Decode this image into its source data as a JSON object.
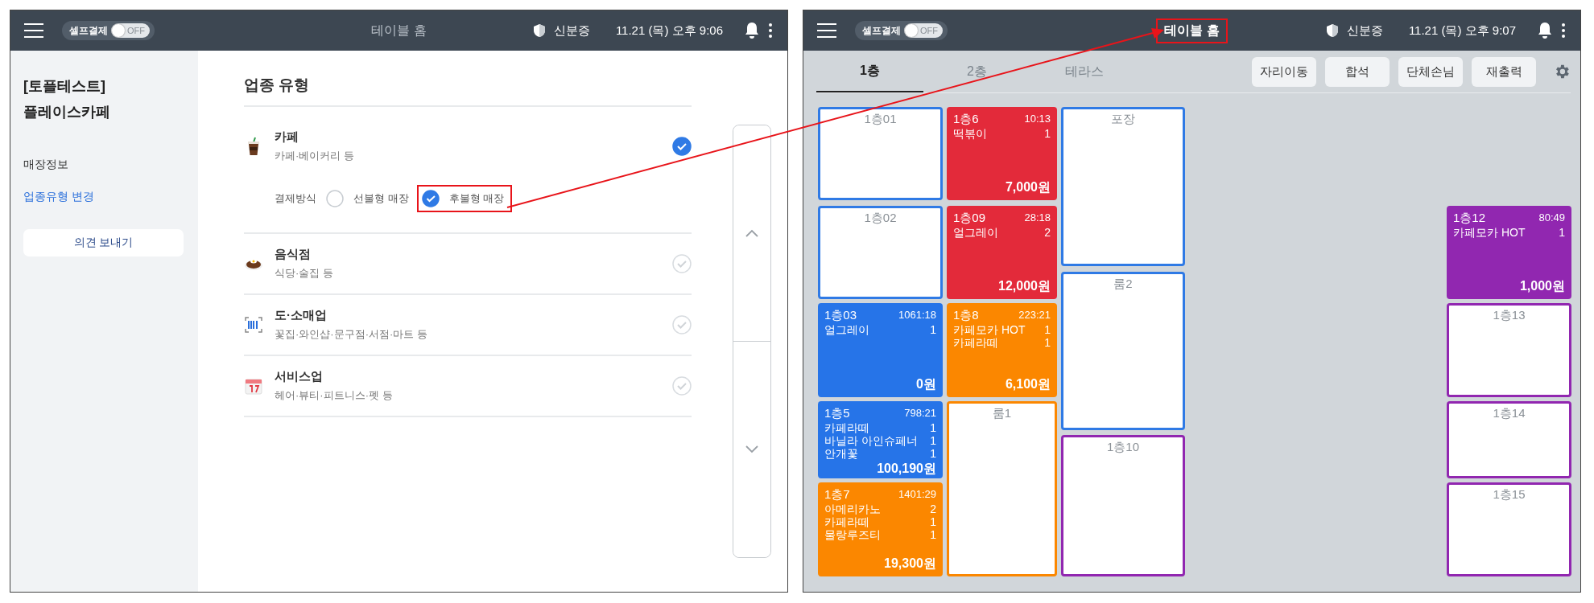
{
  "panels": [
    {
      "kind": "settings",
      "header": {
        "self_pay_label": "셀프결제",
        "self_pay_switch": {
          "text": "OFF",
          "on": false
        },
        "title": "테이블 홈",
        "title_highlighted": false,
        "id_label": "신분증",
        "datetime": "11.21 (목) 오후 9:06"
      },
      "sidebar": {
        "store_name": [
          "[토플테스트]",
          "플레이스카페"
        ],
        "items": [
          {
            "label": "매장정보",
            "selected": false
          },
          {
            "label": "업종유형 변경",
            "selected": true
          }
        ],
        "feedback_button": "의견 보내기"
      },
      "content": {
        "heading": "업종 유형",
        "categories": [
          {
            "name": "카페",
            "description": "카페·베이커리 등",
            "selected": true,
            "payment": {
              "label": "결제방식",
              "options": [
                {
                  "label": "선불형 매장",
                  "selected": false,
                  "highlighted": false
                },
                {
                  "label": "후불형 매장",
                  "selected": true,
                  "highlighted": true
                }
              ]
            }
          },
          {
            "name": "음식점",
            "description": "식당·술집 등",
            "selected": false
          },
          {
            "name": "도·소매업",
            "description": "꽃집·와인샵·문구점·서점·마트 등",
            "selected": false
          },
          {
            "name": "서비스업",
            "description": "헤어·뷰티·피트니스·펫 등",
            "selected": false
          }
        ]
      }
    },
    {
      "kind": "floor",
      "header": {
        "self_pay_label": "셀프결제",
        "self_pay_switch": {
          "text": "OFF",
          "on": false
        },
        "title": "테이블 홈",
        "title_highlighted": true,
        "id_label": "신분증",
        "datetime": "11.21 (목) 오후 9:07"
      },
      "tabs": [
        {
          "label": "1층",
          "selected": true
        },
        {
          "label": "2층",
          "selected": false
        },
        {
          "label": "테라스",
          "selected": false
        }
      ],
      "actions": [
        "자리이동",
        "합석",
        "단체손님",
        "재출력"
      ],
      "tables": [
        {
          "kind": "empty",
          "name": "1층01",
          "color": "#2f7ae5"
        },
        {
          "kind": "empty",
          "name": "1층02",
          "color": "#2f7ae5"
        },
        {
          "kind": "occupied",
          "name": "1층03",
          "time": "1061:18",
          "items": [
            {
              "name": "얼그레이",
              "qty": "1"
            }
          ],
          "total": "0원",
          "color": "#2674e8"
        },
        {
          "kind": "occupied",
          "name": "1층5",
          "time": "798:21",
          "items": [
            {
              "name": "카페라떼",
              "qty": "1"
            },
            {
              "name": "바닐라 아인슈페너",
              "qty": "1"
            },
            {
              "name": "안개꽃",
              "qty": "1"
            }
          ],
          "total": "100,190원",
          "color": "#2674e8"
        },
        {
          "kind": "occupied",
          "name": "1층7",
          "time": "1401:29",
          "items": [
            {
              "name": "아메리카노",
              "qty": "2"
            },
            {
              "name": "카페라떼",
              "qty": "1"
            },
            {
              "name": "물랑루즈티",
              "qty": "1"
            }
          ],
          "total": "19,300원",
          "color": "#fb8700"
        },
        {
          "kind": "occupied",
          "name": "1층6",
          "time": "10:13",
          "items": [
            {
              "name": "떡볶이",
              "qty": "1"
            }
          ],
          "total": "7,000원",
          "color": "#e32a3a"
        },
        {
          "kind": "occupied",
          "name": "1층09",
          "time": "28:18",
          "items": [
            {
              "name": "얼그레이",
              "qty": "2"
            }
          ],
          "total": "12,000원",
          "color": "#e32a3a"
        },
        {
          "kind": "occupied",
          "name": "1층8",
          "time": "223:21",
          "items": [
            {
              "name": "카페모카 HOT",
              "qty": "1"
            },
            {
              "name": "카페라떼",
              "qty": "1"
            }
          ],
          "total": "6,100원",
          "color": "#fb8700"
        },
        {
          "kind": "empty",
          "name": "룸1",
          "color": "#fb8700"
        },
        {
          "kind": "empty",
          "name": "포장",
          "color": "#2f7ae5"
        },
        {
          "kind": "empty",
          "name": "룸2",
          "color": "#2f7ae5"
        },
        {
          "kind": "empty",
          "name": "1층10",
          "color": "#9127b0"
        },
        {
          "kind": "occupied",
          "name": "1층12",
          "time": "80:49",
          "items": [
            {
              "name": "카페모카 HOT",
              "qty": "1"
            }
          ],
          "total": "1,000원",
          "color": "#9127b0"
        },
        {
          "kind": "empty",
          "name": "1층13",
          "color": "#9127b0"
        },
        {
          "kind": "empty",
          "name": "1층14",
          "color": "#9127b0"
        },
        {
          "kind": "empty",
          "name": "1층15",
          "color": "#9127b0"
        }
      ]
    }
  ]
}
